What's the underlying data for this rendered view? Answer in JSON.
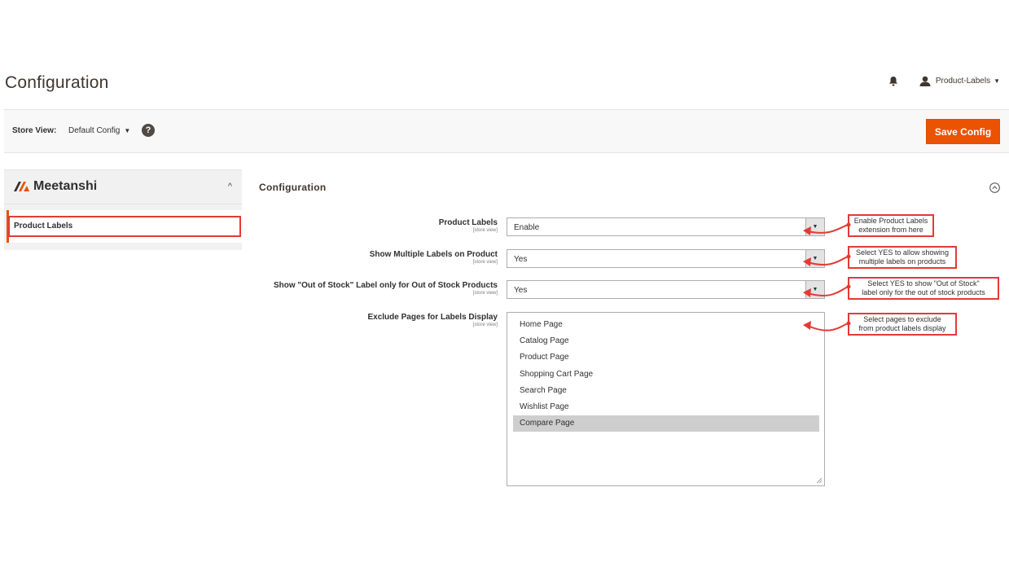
{
  "header": {
    "title": "Configuration",
    "user_name": "Product-Labels"
  },
  "store_bar": {
    "label": "Store View:",
    "value": "Default Config",
    "help": "?",
    "save_label": "Save Config"
  },
  "sidebar": {
    "vendor": "Meetanshi",
    "items": [
      {
        "label": "Product Labels"
      }
    ]
  },
  "section": {
    "title": "Configuration"
  },
  "fields": [
    {
      "label": "Product Labels",
      "scope": "[store view]",
      "value": "Enable"
    },
    {
      "label": "Show Multiple Labels on Product",
      "scope": "[store view]",
      "value": "Yes"
    },
    {
      "label": "Show \"Out of Stock\" Label only for Out of Stock Products",
      "scope": "[store view]",
      "value": "Yes"
    },
    {
      "label": "Exclude Pages for Labels Display",
      "scope": "[store view]"
    }
  ],
  "exclude_options": [
    "Home Page",
    "Catalog Page",
    "Product Page",
    "Shopping Cart Page",
    "Search Page",
    "Wishlist Page",
    "Compare Page"
  ],
  "exclude_selected": "Compare Page",
  "callouts": [
    {
      "line1": "Enable Product Labels",
      "line2": "extension from here"
    },
    {
      "line1": "Select YES to allow showing",
      "line2": "multiple labels on products"
    },
    {
      "line1": "Select YES to show \"Out of Stock\"",
      "line2": "label only for the out of stock products"
    },
    {
      "line1": "Select pages to exclude",
      "line2": "from product labels display"
    }
  ],
  "colors": {
    "accent": "#eb5202",
    "annotation": "#e53935",
    "selected_option": "#cecece"
  },
  "icons": {
    "bell": "bell-icon",
    "user": "user-icon",
    "help": "help-icon",
    "collapse": "collapse-circle-icon"
  }
}
